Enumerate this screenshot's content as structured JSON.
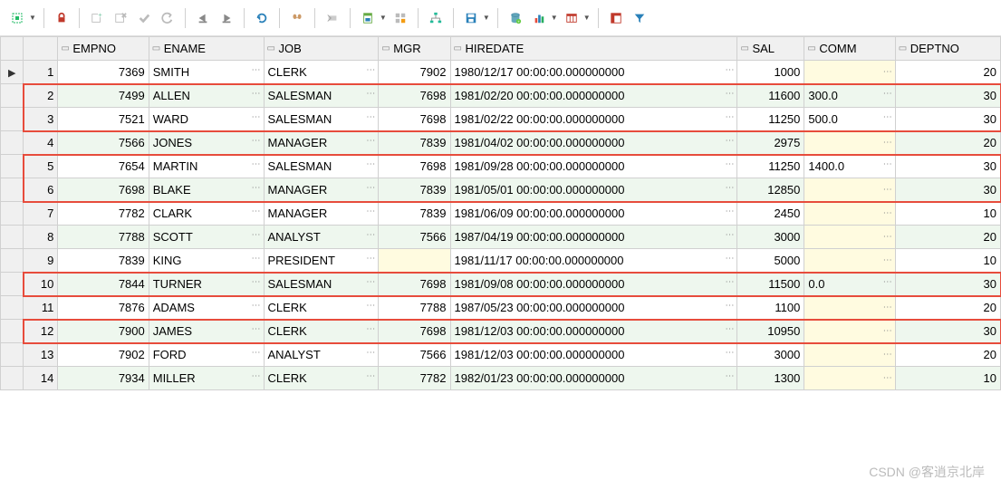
{
  "toolbar_icons": [
    "grid-config-icon",
    "dropdown-icon",
    "sep",
    "lock-icon",
    "sep",
    "new-record-icon",
    "delete-record-icon",
    "commit-icon",
    "rollback-icon",
    "sep",
    "first-icon",
    "last-icon",
    "sep",
    "refresh-icon",
    "sep",
    "find-icon",
    "sep",
    "clear-filter-icon",
    "sep",
    "export-icon",
    "dropdown-icon",
    "group-icon",
    "sep",
    "schema-icon",
    "sep",
    "save-icon",
    "dropdown-icon",
    "sep",
    "database-icon",
    "chart-icon",
    "dropdown-icon",
    "columns-icon",
    "dropdown-icon",
    "sep",
    "pivot-icon",
    "filter-funnel-icon"
  ],
  "columns": [
    {
      "key": "empno",
      "label": "EMPNO",
      "type": "num",
      "dots": false
    },
    {
      "key": "ename",
      "label": "ENAME",
      "type": "txt",
      "dots": true
    },
    {
      "key": "job",
      "label": "JOB",
      "type": "txt",
      "dots": true
    },
    {
      "key": "mgr",
      "label": "MGR",
      "type": "num",
      "dots": false,
      "nullish_if_empty": true
    },
    {
      "key": "hiredate",
      "label": "HIREDATE",
      "type": "txt",
      "dots": true
    },
    {
      "key": "sal",
      "label": "SAL",
      "type": "num",
      "dots": false
    },
    {
      "key": "comm",
      "label": "COMM",
      "type": "txt",
      "dots": true,
      "nullish_if_empty": true
    },
    {
      "key": "deptno",
      "label": "DEPTNO",
      "type": "num",
      "dots": false
    }
  ],
  "rows": [
    {
      "n": 1,
      "marker": "▶",
      "empno": "7369",
      "ename": "SMITH",
      "job": "CLERK",
      "mgr": "7902",
      "hiredate": "1980/12/17 00:00:00.000000000",
      "sal": "1000",
      "comm": "",
      "deptno": "20"
    },
    {
      "n": 2,
      "empno": "7499",
      "ename": "ALLEN",
      "job": "SALESMAN",
      "mgr": "7698",
      "hiredate": "1981/02/20 00:00:00.000000000",
      "sal": "11600",
      "comm": "300.0",
      "deptno": "30"
    },
    {
      "n": 3,
      "empno": "7521",
      "ename": "WARD",
      "job": "SALESMAN",
      "mgr": "7698",
      "hiredate": "1981/02/22 00:00:00.000000000",
      "sal": "11250",
      "comm": "500.0",
      "deptno": "30"
    },
    {
      "n": 4,
      "empno": "7566",
      "ename": "JONES",
      "job": "MANAGER",
      "mgr": "7839",
      "hiredate": "1981/04/02 00:00:00.000000000",
      "sal": "2975",
      "comm": "",
      "deptno": "20"
    },
    {
      "n": 5,
      "empno": "7654",
      "ename": "MARTIN",
      "job": "SALESMAN",
      "mgr": "7698",
      "hiredate": "1981/09/28 00:00:00.000000000",
      "sal": "11250",
      "comm": "1400.0",
      "deptno": "30"
    },
    {
      "n": 6,
      "empno": "7698",
      "ename": "BLAKE",
      "job": "MANAGER",
      "mgr": "7839",
      "hiredate": "1981/05/01 00:00:00.000000000",
      "sal": "12850",
      "comm": "",
      "deptno": "30"
    },
    {
      "n": 7,
      "empno": "7782",
      "ename": "CLARK",
      "job": "MANAGER",
      "mgr": "7839",
      "hiredate": "1981/06/09 00:00:00.000000000",
      "sal": "2450",
      "comm": "",
      "deptno": "10"
    },
    {
      "n": 8,
      "empno": "7788",
      "ename": "SCOTT",
      "job": "ANALYST",
      "mgr": "7566",
      "hiredate": "1987/04/19 00:00:00.000000000",
      "sal": "3000",
      "comm": "",
      "deptno": "20"
    },
    {
      "n": 9,
      "empno": "7839",
      "ename": "KING",
      "job": "PRESIDENT",
      "mgr": "",
      "hiredate": "1981/11/17 00:00:00.000000000",
      "sal": "5000",
      "comm": "",
      "deptno": "10"
    },
    {
      "n": 10,
      "empno": "7844",
      "ename": "TURNER",
      "job": "SALESMAN",
      "mgr": "7698",
      "hiredate": "1981/09/08 00:00:00.000000000",
      "sal": "11500",
      "comm": "0.0",
      "deptno": "30"
    },
    {
      "n": 11,
      "empno": "7876",
      "ename": "ADAMS",
      "job": "CLERK",
      "mgr": "7788",
      "hiredate": "1987/05/23 00:00:00.000000000",
      "sal": "1100",
      "comm": "",
      "deptno": "20"
    },
    {
      "n": 12,
      "empno": "7900",
      "ename": "JAMES",
      "job": "CLERK",
      "mgr": "7698",
      "hiredate": "1981/12/03 00:00:00.000000000",
      "sal": "10950",
      "comm": "",
      "deptno": "30"
    },
    {
      "n": 13,
      "empno": "7902",
      "ename": "FORD",
      "job": "ANALYST",
      "mgr": "7566",
      "hiredate": "1981/12/03 00:00:00.000000000",
      "sal": "3000",
      "comm": "",
      "deptno": "20"
    },
    {
      "n": 14,
      "empno": "7934",
      "ename": "MILLER",
      "job": "CLERK",
      "mgr": "7782",
      "hiredate": "1982/01/23 00:00:00.000000000",
      "sal": "1300",
      "comm": "",
      "deptno": "10"
    }
  ],
  "highlight_groups": [
    [
      2,
      3
    ],
    [
      5,
      6
    ],
    [
      10
    ],
    [
      12
    ]
  ],
  "watermark": "CSDN @客逍京北岸"
}
